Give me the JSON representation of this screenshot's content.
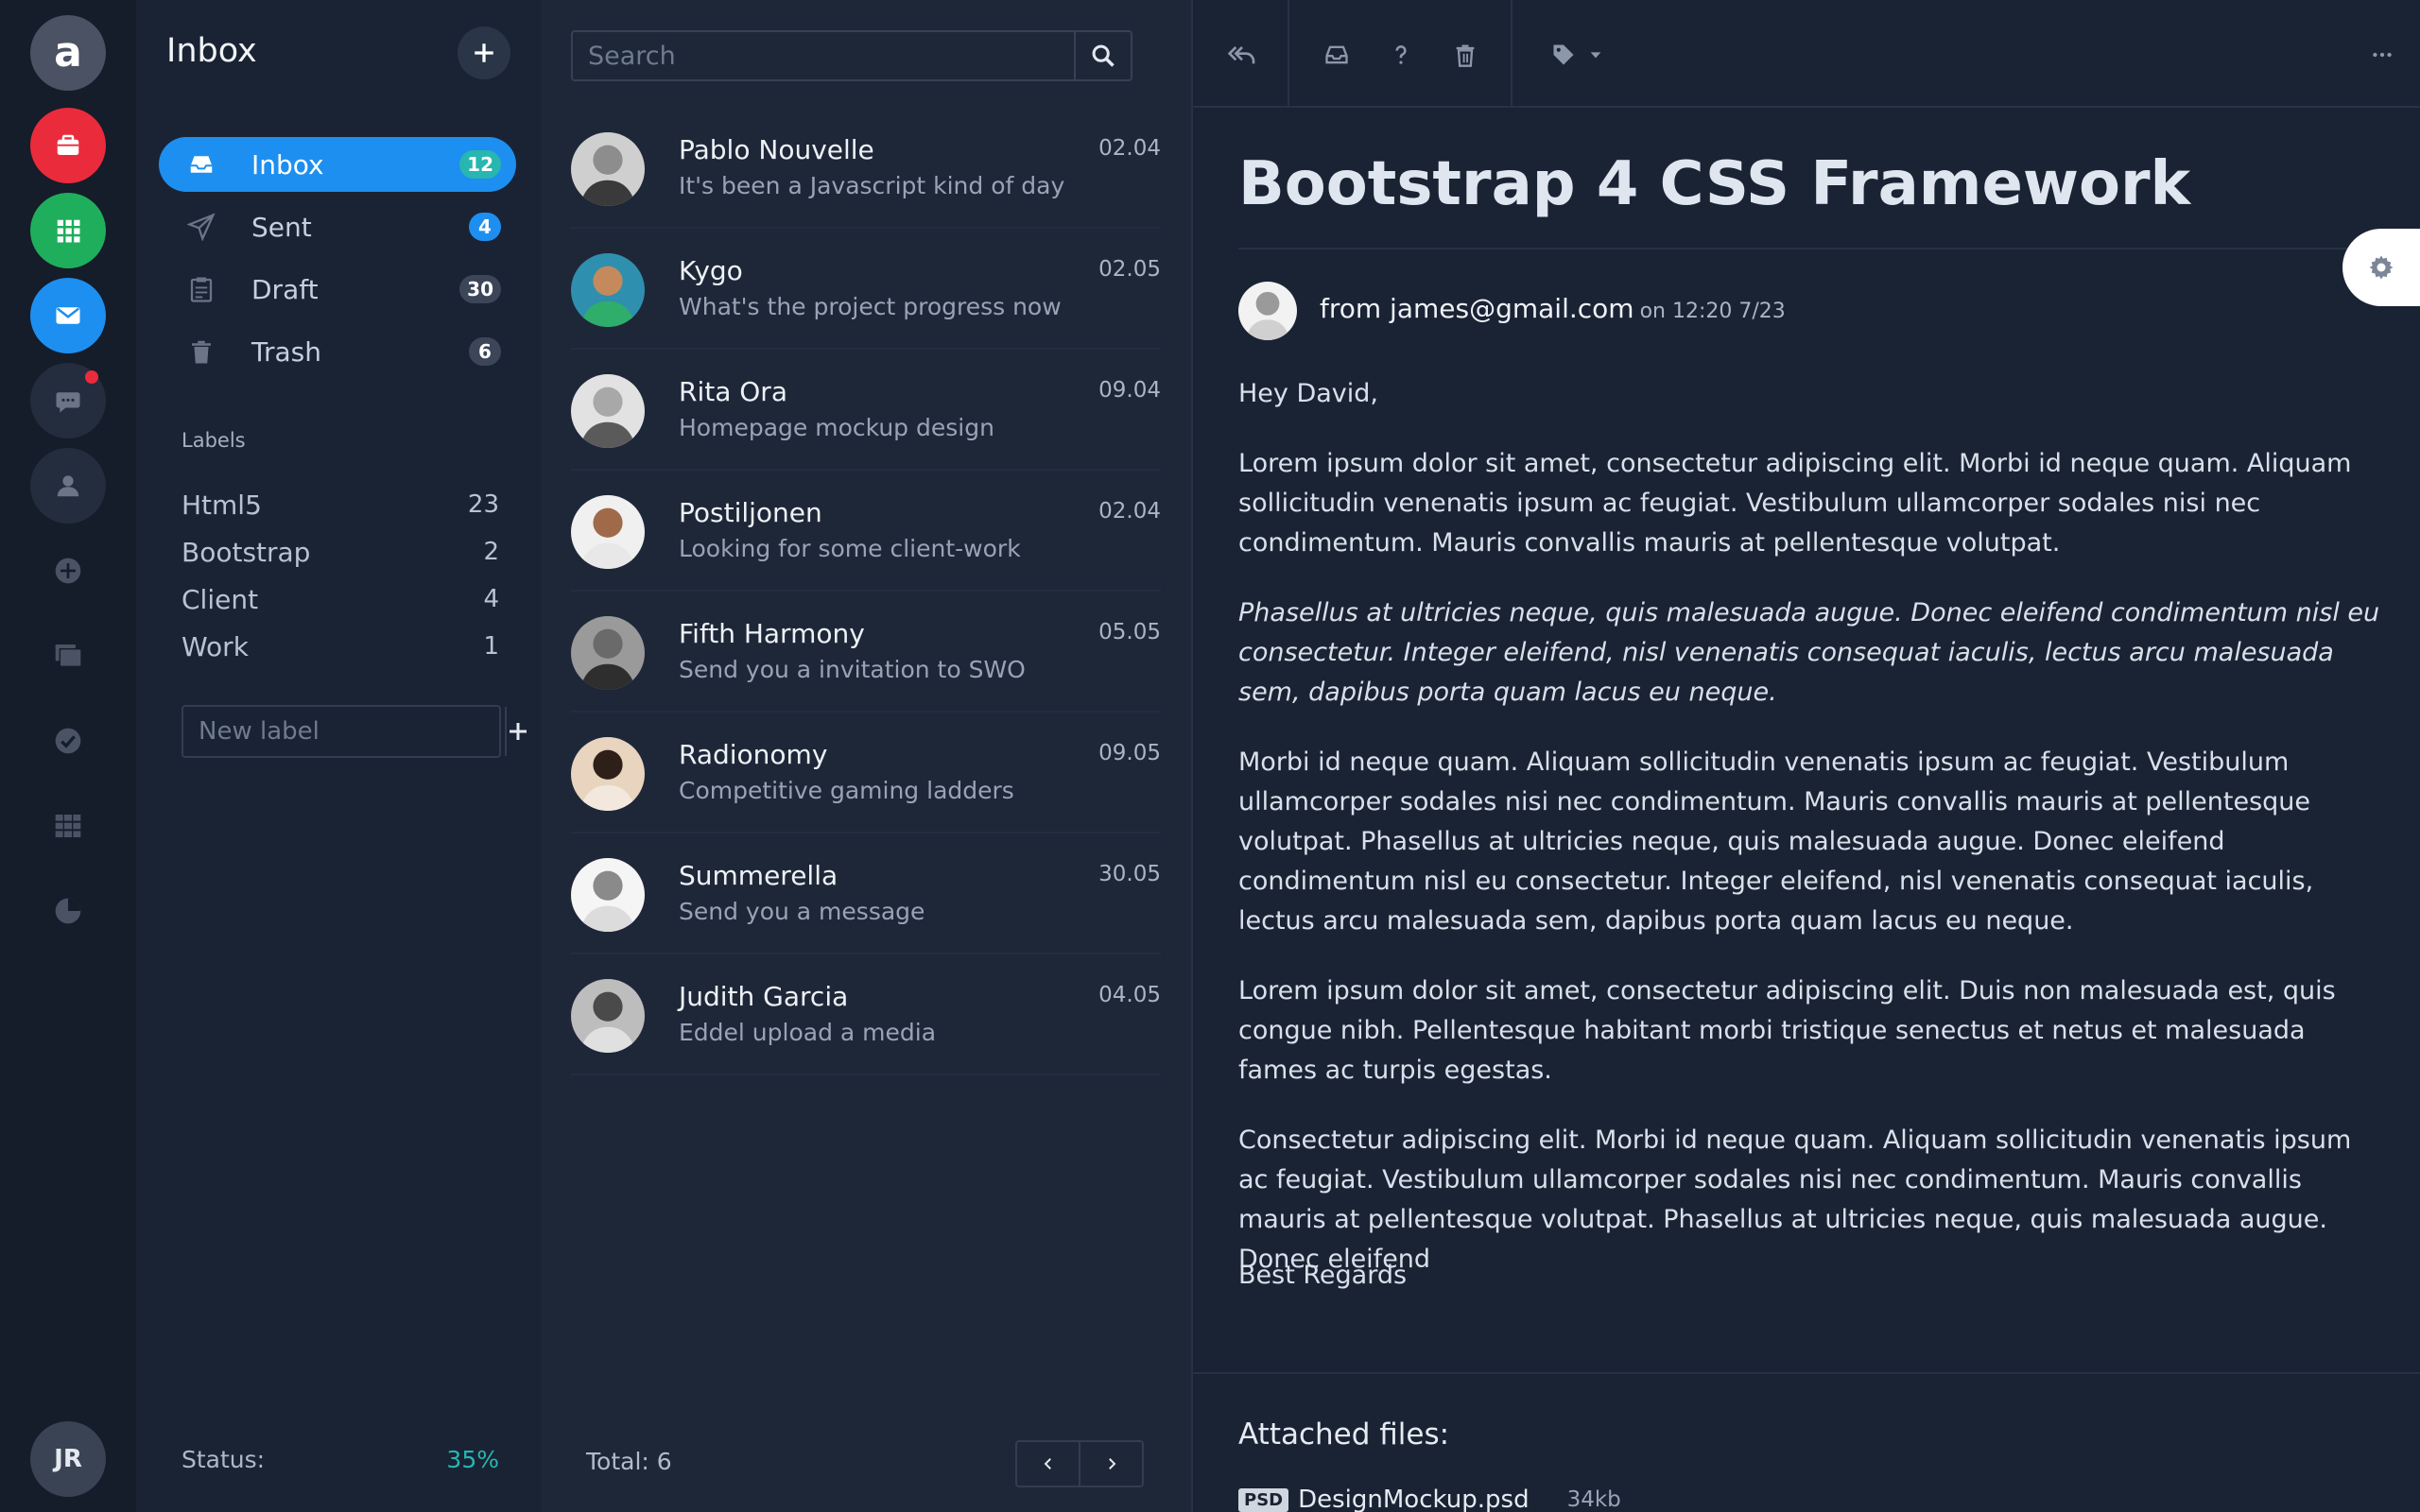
{
  "colors": {
    "accent_blue": "#1d8ff0",
    "red": "#ea2b3b",
    "green": "#1fae5b",
    "teal": "#27b6b0",
    "dark_bg": "#1a2334"
  },
  "rail": {
    "logo_letter": "a",
    "user_initials": "JR",
    "icons": [
      "briefcase-icon",
      "apps-grid-icon",
      "mail-icon",
      "chat-icon",
      "user-icon",
      "add-circle-icon",
      "layers-icon",
      "check-circle-icon",
      "table-icon",
      "pie-chart-icon"
    ]
  },
  "folders": {
    "title": "Inbox",
    "items": [
      {
        "label": "Inbox",
        "count": "12",
        "icon": "inbox-icon"
      },
      {
        "label": "Sent",
        "count": "4",
        "icon": "send-icon"
      },
      {
        "label": "Draft",
        "count": "30",
        "icon": "clipboard-icon"
      },
      {
        "label": "Trash",
        "count": "6",
        "icon": "trash-icon"
      }
    ],
    "labels_heading": "Labels",
    "labels": [
      {
        "name": "Html5",
        "count": "23"
      },
      {
        "name": "Bootstrap",
        "count": "2"
      },
      {
        "name": "Client",
        "count": "4"
      },
      {
        "name": "Work",
        "count": "1"
      }
    ],
    "new_label_placeholder": "New label",
    "status_label": "Status:",
    "status_value": "35%"
  },
  "messages": {
    "search_placeholder": "Search",
    "items": [
      {
        "from": "Pablo Nouvelle",
        "subject": "It's been a Javascript kind of day",
        "date": "02.04"
      },
      {
        "from": "Kygo",
        "subject": "What's the project progress now",
        "date": "02.05"
      },
      {
        "from": "Rita Ora",
        "subject": "Homepage mockup design",
        "date": "09.04"
      },
      {
        "from": "Postiljonen",
        "subject": "Looking for some client-work",
        "date": "02.04"
      },
      {
        "from": "Fifth Harmony",
        "subject": "Send you a invitation to SWO",
        "date": "05.05"
      },
      {
        "from": "Radionomy",
        "subject": "Competitive gaming ladders",
        "date": "09.05"
      },
      {
        "from": "Summerella",
        "subject": "Send you a message",
        "date": "30.05"
      },
      {
        "from": "Judith Garcia",
        "subject": "Eddel upload a media",
        "date": "04.05"
      }
    ],
    "total": "Total: 6"
  },
  "reader": {
    "title": "Bootstrap 4 CSS Framework",
    "from_text": "from james@gmail.com",
    "when": "on 12:20 7/23",
    "greeting": "Hey David,",
    "paragraphs": [
      "Lorem ipsum dolor sit amet, consectetur adipiscing elit. Morbi id neque quam. Aliquam sollicitudin venenatis ipsum ac feugiat. Vestibulum ullamcorper sodales nisi nec condimentum. Mauris convallis mauris at pellentesque volutpat.",
      "Phasellus at ultricies neque, quis malesuada augue. Donec eleifend condimentum nisl eu consectetur. Integer eleifend, nisl venenatis consequat iaculis, lectus arcu malesuada sem, dapibus porta quam lacus eu neque.",
      "Morbi id neque quam. Aliquam sollicitudin venenatis ipsum ac feugiat. Vestibulum ullamcorper sodales nisi nec condimentum. Mauris convallis mauris at pellentesque volutpat. Phasellus at ultricies neque, quis malesuada augue. Donec eleifend condimentum nisl eu consectetur. Integer eleifend, nisl venenatis consequat iaculis, lectus arcu malesuada sem, dapibus porta quam lacus eu neque.",
      "Lorem ipsum dolor sit amet, consectetur adipiscing elit. Duis non malesuada est, quis congue nibh. Pellentesque habitant morbi tristique senectus et netus et malesuada fames ac turpis egestas.",
      "Consectetur adipiscing elit. Morbi id neque quam. Aliquam sollicitudin venenatis ipsum ac feugiat. Vestibulum ullamcorper sodales nisi nec condimentum. Mauris convallis mauris at pellentesque volutpat. Phasellus at ultricies neque, quis malesuada augue. Donec eleifend"
    ],
    "regards": "Best Regards",
    "attached_title": "Attached files:",
    "attachment": {
      "ext": "PSD",
      "name": "DesignMockup.psd",
      "size": "34kb"
    }
  }
}
